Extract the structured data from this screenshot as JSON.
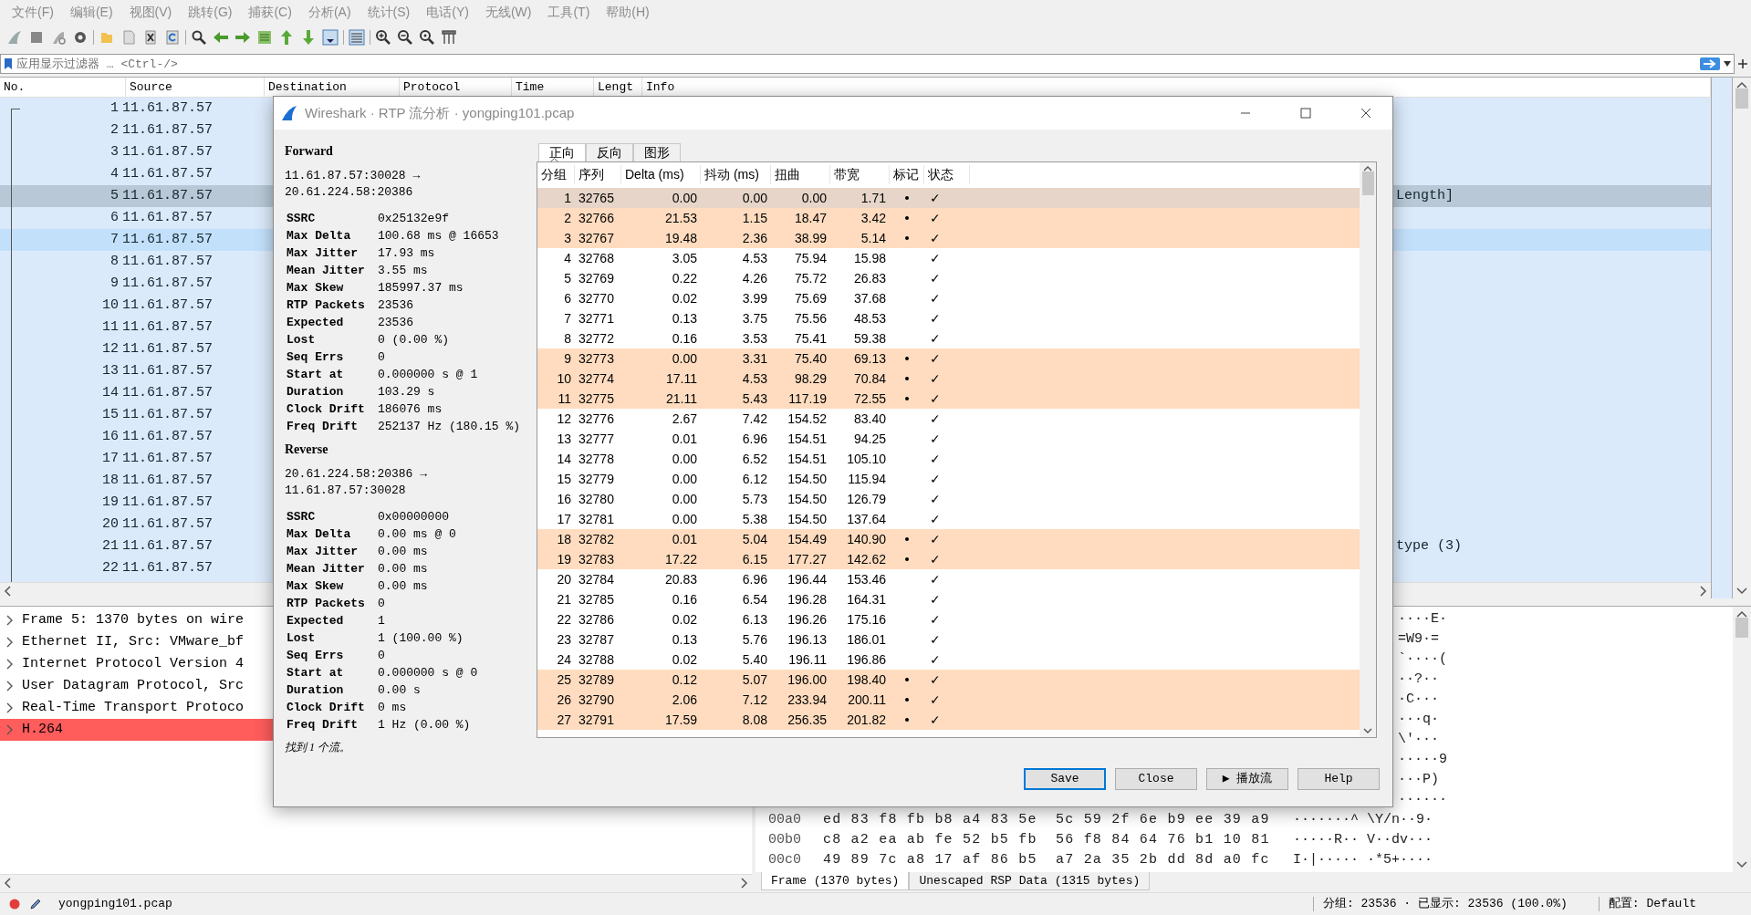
{
  "menu": [
    "文件(F)",
    "编辑(E)",
    "视图(V)",
    "跳转(G)",
    "捕获(C)",
    "分析(A)",
    "统计(S)",
    "电话(Y)",
    "无线(W)",
    "工具(T)",
    "帮助(H)"
  ],
  "filter": {
    "placeholder": "应用显示过滤器 … <Ctrl-/>"
  },
  "packet_list": {
    "columns": [
      "No.",
      "Source",
      "Destination",
      "Protocol",
      "Time",
      "Lengt",
      "Info"
    ],
    "rows": [
      {
        "no": "1",
        "source": "11.61.87.57",
        "selected": false,
        "highlighted": false
      },
      {
        "no": "2",
        "source": "11.61.87.57",
        "selected": false,
        "highlighted": false
      },
      {
        "no": "3",
        "source": "11.61.87.57",
        "selected": false,
        "highlighted": false
      },
      {
        "no": "4",
        "source": "11.61.87.57",
        "selected": false,
        "highlighted": false
      },
      {
        "no": "5",
        "source": "11.61.87.57",
        "info": "Length]",
        "selected": true,
        "highlighted": false
      },
      {
        "no": "6",
        "source": "11.61.87.57",
        "selected": false,
        "highlighted": false
      },
      {
        "no": "7",
        "source": "11.61.87.57",
        "selected": false,
        "highlighted": true
      },
      {
        "no": "8",
        "source": "11.61.87.57",
        "selected": false,
        "highlighted": false
      },
      {
        "no": "9",
        "source": "11.61.87.57",
        "selected": false,
        "highlighted": false
      },
      {
        "no": "10",
        "source": "11.61.87.57",
        "selected": false,
        "highlighted": false
      },
      {
        "no": "11",
        "source": "11.61.87.57",
        "selected": false,
        "highlighted": false
      },
      {
        "no": "12",
        "source": "11.61.87.57",
        "selected": false,
        "highlighted": false
      },
      {
        "no": "13",
        "source": "11.61.87.57",
        "selected": false,
        "highlighted": false
      },
      {
        "no": "14",
        "source": "11.61.87.57",
        "selected": false,
        "highlighted": false
      },
      {
        "no": "15",
        "source": "11.61.87.57",
        "selected": false,
        "highlighted": false
      },
      {
        "no": "16",
        "source": "11.61.87.57",
        "selected": false,
        "highlighted": false
      },
      {
        "no": "17",
        "source": "11.61.87.57",
        "selected": false,
        "highlighted": false
      },
      {
        "no": "18",
        "source": "11.61.87.57",
        "selected": false,
        "highlighted": false
      },
      {
        "no": "19",
        "source": "11.61.87.57",
        "selected": false,
        "highlighted": false
      },
      {
        "no": "20",
        "source": "11.61.87.57",
        "selected": false,
        "highlighted": false
      },
      {
        "no": "21",
        "source": "11.61.87.57",
        "info": "type (3)",
        "selected": false,
        "highlighted": false
      },
      {
        "no": "22",
        "source": "11.61.87.57",
        "selected": false,
        "highlighted": false
      }
    ]
  },
  "packet_details": [
    {
      "label": "Frame 5: 1370 bytes on wire",
      "expanded": false,
      "flagged": false
    },
    {
      "label": "Ethernet II, Src: VMware_bf",
      "expanded": false,
      "flagged": false
    },
    {
      "label": "Internet Protocol Version 4",
      "expanded": false,
      "flagged": false
    },
    {
      "label": "User Datagram Protocol, Src",
      "expanded": false,
      "flagged": false
    },
    {
      "label": "Real-Time Transport Protoco",
      "expanded": false,
      "flagged": false
    },
    {
      "label": "H.264",
      "expanded": false,
      "flagged": true
    }
  ],
  "hex_dump": [
    {
      "ascii": "····E·"
    },
    {
      "ascii": "=W9·="
    },
    {
      "ascii": "`····("
    },
    {
      "ascii": "··?··"
    },
    {
      "ascii": "·C···"
    },
    {
      "ascii": "···q·"
    },
    {
      "ascii": "\\'···"
    },
    {
      "ascii": "·····9"
    },
    {
      "ascii": "···P)"
    },
    {
      "ascii": "······"
    },
    {
      "offset": "00a0",
      "hex": "ed 83 f8 fb b8 a4 83 5e  5c 59 2f 6e b9 ee 39 a9",
      "ascii": "·······^ \\Y/n··9·"
    },
    {
      "offset": "00b0",
      "hex": "c8 a2 ea ab fe 52 b5 fb  56 f8 84 64 76 b1 10 81",
      "ascii": "·····R·· V··dv···"
    },
    {
      "offset": "00c0",
      "hex": "49 89 7c a8 17 af 86 b5  a7 2a 35 2b dd 8d a0 fc",
      "ascii": "I·|····· ·*5+····"
    }
  ],
  "byte_tabs": [
    {
      "label": "Frame (1370 bytes)",
      "selected": true
    },
    {
      "label": "Unescaped RSP Data (1315 bytes)",
      "selected": false
    }
  ],
  "status_bar": {
    "file": "yongping101.pcap",
    "packets": "分组: 23536 · 已显示: 23536 (100.0%)",
    "profile": "配置: Default"
  },
  "dialog": {
    "title": "Wireshark · RTP 流分析 · yongping101.pcap",
    "sections": [
      {
        "heading": "Forward",
        "endpoints": [
          "11.61.87.57:30028 →",
          "20.61.224.58:20386"
        ],
        "stats": [
          {
            "label": "SSRC",
            "value": "0x25132e9f"
          },
          {
            "label": "Max Delta",
            "value": "100.68 ms @ 16653"
          },
          {
            "label": "Max Jitter",
            "value": "17.93 ms"
          },
          {
            "label": "Mean Jitter",
            "value": "3.55 ms"
          },
          {
            "label": "Max Skew",
            "value": "185997.37 ms"
          },
          {
            "label": "RTP Packets",
            "value": "23536"
          },
          {
            "label": "Expected",
            "value": "23536"
          },
          {
            "label": "Lost",
            "value": "0 (0.00 %)"
          },
          {
            "label": "Seq Errs",
            "value": "0"
          },
          {
            "label": "Start at",
            "value": "0.000000 s @ 1"
          },
          {
            "label": "Duration",
            "value": "103.29 s"
          },
          {
            "label": "Clock Drift",
            "value": "186076 ms"
          },
          {
            "label": "Freq Drift",
            "value": "252137 Hz (180.15 %)"
          }
        ]
      },
      {
        "heading": "Reverse",
        "endpoints": [
          "20.61.224.58:20386 →",
          "11.61.87.57:30028"
        ],
        "stats": [
          {
            "label": "SSRC",
            "value": "0x00000000"
          },
          {
            "label": "Max Delta",
            "value": "0.00 ms @ 0"
          },
          {
            "label": "Max Jitter",
            "value": "0.00 ms"
          },
          {
            "label": "Mean Jitter",
            "value": "0.00 ms"
          },
          {
            "label": "Max Skew",
            "value": "0.00 ms"
          },
          {
            "label": "RTP Packets",
            "value": "0"
          },
          {
            "label": "Expected",
            "value": "1"
          },
          {
            "label": "Lost",
            "value": "1 (100.00 %)"
          },
          {
            "label": "Seq Errs",
            "value": "0"
          },
          {
            "label": "Start at",
            "value": "0.000000 s @ 0"
          },
          {
            "label": "Duration",
            "value": "0.00 s"
          },
          {
            "label": "Clock Drift",
            "value": "0 ms"
          },
          {
            "label": "Freq Drift",
            "value": "1 Hz (0.00 %)"
          }
        ]
      }
    ],
    "found": "找到 1 个流。",
    "tabs": [
      {
        "label": "正向",
        "selected": true
      },
      {
        "label": "反向",
        "selected": false
      },
      {
        "label": "图形",
        "selected": false
      }
    ],
    "columns": [
      "分组",
      "序列",
      "Delta (ms)",
      "抖动 (ms)",
      "扭曲",
      "带宽",
      "标记",
      "状态"
    ],
    "rows": [
      {
        "cells": [
          "1",
          "32765",
          "0.00",
          "0.00",
          "0.00",
          "1.71"
        ],
        "marker": true,
        "selected": true,
        "status": "✓"
      },
      {
        "cells": [
          "2",
          "32766",
          "21.53",
          "1.15",
          "18.47",
          "3.42"
        ],
        "marker": true,
        "selected": false,
        "status": "✓"
      },
      {
        "cells": [
          "3",
          "32767",
          "19.48",
          "2.36",
          "38.99",
          "5.14"
        ],
        "marker": true,
        "selected": false,
        "status": "✓"
      },
      {
        "cells": [
          "4",
          "32768",
          "3.05",
          "4.53",
          "75.94",
          "15.98"
        ],
        "marker": false,
        "selected": false,
        "status": "✓"
      },
      {
        "cells": [
          "5",
          "32769",
          "0.22",
          "4.26",
          "75.72",
          "26.83"
        ],
        "marker": false,
        "selected": false,
        "status": "✓"
      },
      {
        "cells": [
          "6",
          "32770",
          "0.02",
          "3.99",
          "75.69",
          "37.68"
        ],
        "marker": false,
        "selected": false,
        "status": "✓"
      },
      {
        "cells": [
          "7",
          "32771",
          "0.13",
          "3.75",
          "75.56",
          "48.53"
        ],
        "marker": false,
        "selected": false,
        "status": "✓"
      },
      {
        "cells": [
          "8",
          "32772",
          "0.16",
          "3.53",
          "75.41",
          "59.38"
        ],
        "marker": false,
        "selected": false,
        "status": "✓"
      },
      {
        "cells": [
          "9",
          "32773",
          "0.00",
          "3.31",
          "75.40",
          "69.13"
        ],
        "marker": true,
        "selected": false,
        "status": "✓"
      },
      {
        "cells": [
          "10",
          "32774",
          "17.11",
          "4.53",
          "98.29",
          "70.84"
        ],
        "marker": true,
        "selected": false,
        "status": "✓"
      },
      {
        "cells": [
          "11",
          "32775",
          "21.11",
          "5.43",
          "117.19",
          "72.55"
        ],
        "marker": true,
        "selected": false,
        "status": "✓"
      },
      {
        "cells": [
          "12",
          "32776",
          "2.67",
          "7.42",
          "154.52",
          "83.40"
        ],
        "marker": false,
        "selected": false,
        "status": "✓"
      },
      {
        "cells": [
          "13",
          "32777",
          "0.01",
          "6.96",
          "154.51",
          "94.25"
        ],
        "marker": false,
        "selected": false,
        "status": "✓"
      },
      {
        "cells": [
          "14",
          "32778",
          "0.00",
          "6.52",
          "154.51",
          "105.10"
        ],
        "marker": false,
        "selected": false,
        "status": "✓"
      },
      {
        "cells": [
          "15",
          "32779",
          "0.00",
          "6.12",
          "154.50",
          "115.94"
        ],
        "marker": false,
        "selected": false,
        "status": "✓"
      },
      {
        "cells": [
          "16",
          "32780",
          "0.00",
          "5.73",
          "154.50",
          "126.79"
        ],
        "marker": false,
        "selected": false,
        "status": "✓"
      },
      {
        "cells": [
          "17",
          "32781",
          "0.00",
          "5.38",
          "154.50",
          "137.64"
        ],
        "marker": false,
        "selected": false,
        "status": "✓"
      },
      {
        "cells": [
          "18",
          "32782",
          "0.01",
          "5.04",
          "154.49",
          "140.90"
        ],
        "marker": true,
        "selected": false,
        "status": "✓"
      },
      {
        "cells": [
          "19",
          "32783",
          "17.22",
          "6.15",
          "177.27",
          "142.62"
        ],
        "marker": true,
        "selected": false,
        "status": "✓"
      },
      {
        "cells": [
          "20",
          "32784",
          "20.83",
          "6.96",
          "196.44",
          "153.46"
        ],
        "marker": false,
        "selected": false,
        "status": "✓"
      },
      {
        "cells": [
          "21",
          "32785",
          "0.16",
          "6.54",
          "196.28",
          "164.31"
        ],
        "marker": false,
        "selected": false,
        "status": "✓"
      },
      {
        "cells": [
          "22",
          "32786",
          "0.02",
          "6.13",
          "196.26",
          "175.16"
        ],
        "marker": false,
        "selected": false,
        "status": "✓"
      },
      {
        "cells": [
          "23",
          "32787",
          "0.13",
          "5.76",
          "196.13",
          "186.01"
        ],
        "marker": false,
        "selected": false,
        "status": "✓"
      },
      {
        "cells": [
          "24",
          "32788",
          "0.02",
          "5.40",
          "196.11",
          "196.86"
        ],
        "marker": false,
        "selected": false,
        "status": "✓"
      },
      {
        "cells": [
          "25",
          "32789",
          "0.12",
          "5.07",
          "196.00",
          "198.40"
        ],
        "marker": true,
        "selected": false,
        "status": "✓"
      },
      {
        "cells": [
          "26",
          "32790",
          "2.06",
          "7.12",
          "233.94",
          "200.11"
        ],
        "marker": true,
        "selected": false,
        "status": "✓"
      },
      {
        "cells": [
          "27",
          "32791",
          "17.59",
          "8.08",
          "256.35",
          "201.82"
        ],
        "marker": true,
        "selected": false,
        "status": "✓"
      }
    ],
    "buttons": [
      {
        "label": "Save",
        "default": true
      },
      {
        "label": "Close",
        "default": false
      },
      {
        "label": "▶ 播放流",
        "default": false
      },
      {
        "label": "Help",
        "default": false
      }
    ]
  }
}
